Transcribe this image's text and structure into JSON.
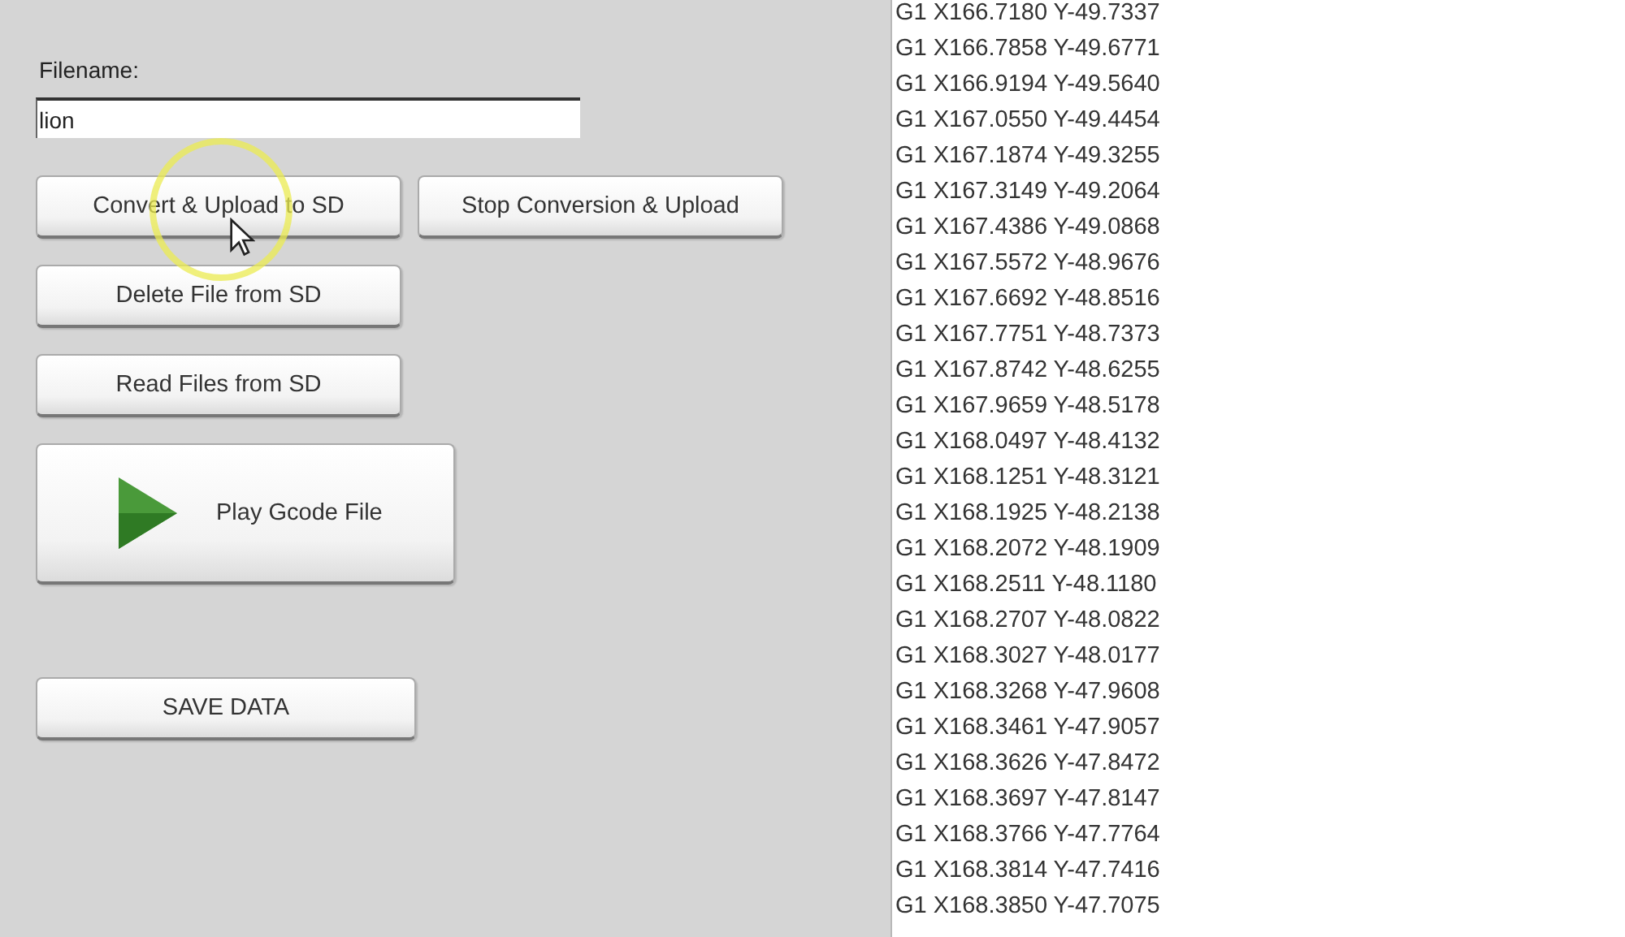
{
  "filename": {
    "label": "Filename:",
    "value": "lion"
  },
  "button_rows": [
    [
      {
        "label": "Convert & Upload to SD",
        "kind": "plain"
      },
      {
        "label": "Stop Conversion & Upload",
        "kind": "plain"
      }
    ],
    [
      {
        "label": "Delete File from SD",
        "kind": "plain"
      }
    ],
    [
      {
        "label": "Read Files from SD",
        "kind": "plain"
      }
    ],
    [
      {
        "label": "Play Gcode File",
        "kind": "play"
      }
    ],
    [
      {
        "label": "SAVE DATA",
        "kind": "save"
      }
    ]
  ],
  "gcode_lines": [
    "G1 X166.7180 Y-49.7337",
    "G1 X166.7858 Y-49.6771",
    "G1 X166.9194 Y-49.5640",
    "G1 X167.0550 Y-49.4454",
    "G1 X167.1874 Y-49.3255",
    "G1 X167.3149 Y-49.2064",
    "G1 X167.4386 Y-49.0868",
    "G1 X167.5572 Y-48.9676",
    "G1 X167.6692 Y-48.8516",
    "G1 X167.7751 Y-48.7373",
    "G1 X167.8742 Y-48.6255",
    "G1 X167.9659 Y-48.5178",
    "G1 X168.0497 Y-48.4132",
    "G1 X168.1251 Y-48.3121",
    "G1 X168.1925 Y-48.2138",
    "G1 X168.2072 Y-48.1909",
    "G1 X168.2511 Y-48.1180",
    "G1 X168.2707 Y-48.0822",
    "G1 X168.3027 Y-48.0177",
    "G1 X168.3268 Y-47.9608",
    "G1 X168.3461 Y-47.9057",
    "G1 X168.3626 Y-47.8472",
    "G1 X168.3697 Y-47.8147",
    "G1 X168.3766 Y-47.7764",
    "G1 X168.3814 Y-47.7416",
    "G1 X168.3850 Y-47.7075"
  ]
}
